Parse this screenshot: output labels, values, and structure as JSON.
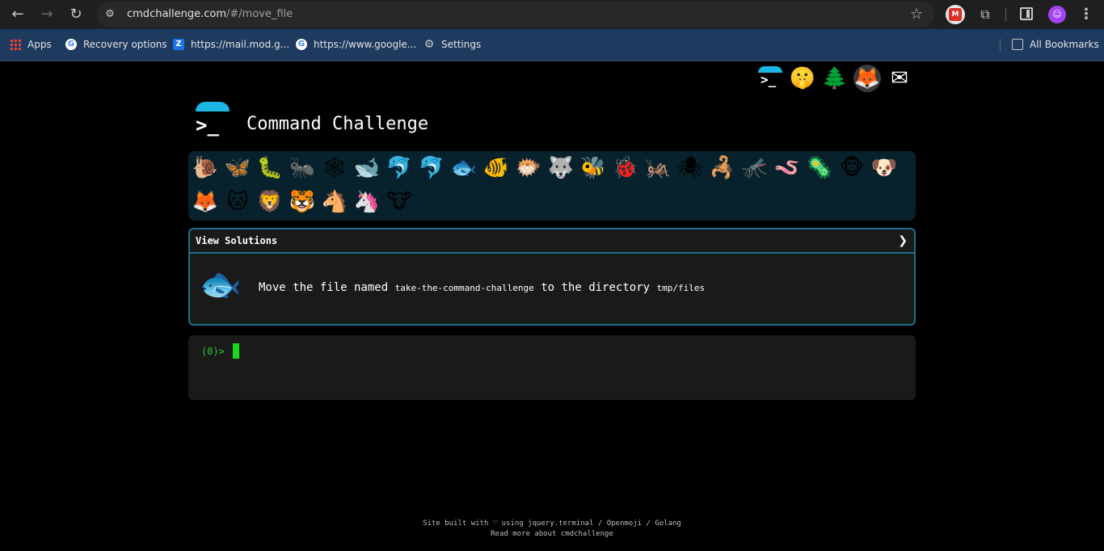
{
  "browser": {
    "url_host": "cmdchallenge.com",
    "url_path": "/#/move_file",
    "bookmarks": [
      {
        "label": "Apps",
        "icon": "apps-grid-icon"
      },
      {
        "label": "Recovery options",
        "icon": "google-icon"
      },
      {
        "label": "https://mail.mod.g...",
        "icon": "zoho-icon"
      },
      {
        "label": "https://www.google...",
        "icon": "google-icon"
      },
      {
        "label": "Settings",
        "icon": "gear-icon"
      }
    ],
    "all_bookmarks": "All Bookmarks"
  },
  "header": {
    "title": "Command Challenge",
    "social_icons": [
      "terminal-logo-icon",
      "shushing-face-icon",
      "tree-icon",
      "gitlab-icon",
      "mail-icon"
    ]
  },
  "animals": [
    "🐌",
    "🦋",
    "🐛",
    "🐜",
    "🕸",
    "🐋",
    "🐬",
    "🐬",
    "🐟",
    "🐠",
    "🐡",
    "🐺",
    "🐝",
    "🐞",
    "🦗",
    "🕷",
    "🦂",
    "🦟",
    "🪱",
    "🦠",
    "🐵",
    "🐶",
    "🦊",
    "🐱",
    "🦁",
    "🐯",
    "🐴",
    "🦄",
    "🐮"
  ],
  "challenge": {
    "view_solutions": "View Solutions",
    "chevron": "❯",
    "task_prefix": "Move the file named ",
    "task_file": "take-the-command-challenge",
    "task_middle": " to the directory ",
    "task_dir": "tmp/files"
  },
  "terminal": {
    "prompt": "(0)>"
  },
  "footer": {
    "line1": "Site built with ♡ using jquery.terminal / Openmoji / Golang",
    "line2": "Read more about cmdchallenge"
  },
  "colors": {
    "accent": "#1bb8e6",
    "panel_border": "#1c6e8c",
    "prompt": "#27c93f"
  }
}
